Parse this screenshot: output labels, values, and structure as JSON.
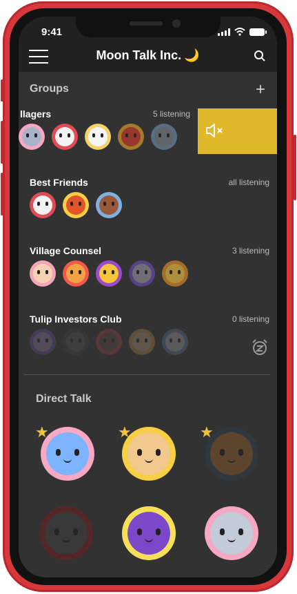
{
  "status": {
    "time": "9:41"
  },
  "header": {
    "title": "Moon Talk Inc.",
    "title_icon": "🌙"
  },
  "groups_section": {
    "title": "Groups",
    "add_label": "+"
  },
  "groups": [
    {
      "name": "llagers",
      "listening": "5 listening"
    },
    {
      "name": "Best Friends",
      "listening": "all listening"
    },
    {
      "name": "Village Counsel",
      "listening": "3 listening"
    },
    {
      "name": "Tulip Investors Club",
      "listening": "0 listening"
    }
  ],
  "direct_section": {
    "title": "Direct Talk"
  },
  "colors": {
    "background": "#333232",
    "header": "#222121",
    "swipe_action": "#dfb82c",
    "star": "#f2c23c",
    "frame": "#d8383c"
  },
  "icons": [
    "menu-icon",
    "search-icon",
    "mute-icon",
    "snooze-alarm-icon",
    "star-icon",
    "moon-icon"
  ]
}
